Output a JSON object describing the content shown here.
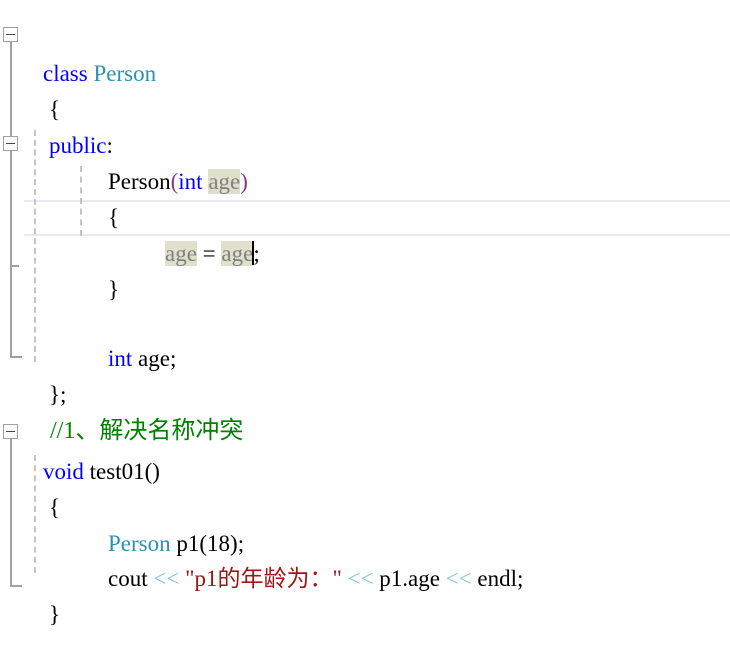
{
  "editor": {
    "language": "cpp",
    "colors": {
      "background": "#ffffff",
      "keyword": "#0000ff",
      "user_type": "#2b91af",
      "string": "#a31515",
      "comment": "#008000",
      "stream_operator": "#7fc3e0",
      "bracket_match": "#8b3a8b",
      "reference_highlight_bg": "#dfe0cb",
      "reference_highlight_fg": "#808080",
      "current_line_border": "#e9e9f3",
      "outline_margin": "#a0a0a0",
      "indent_guide": "#c4c4c4",
      "plain_text": "#000000"
    },
    "caret": {
      "line_index": 5,
      "after_text": "age"
    },
    "lines": [
      {
        "index": 0,
        "text": "class Person",
        "tokens": [
          {
            "t": "class",
            "c": "kw"
          },
          {
            "t": " ",
            "c": "plain"
          },
          {
            "t": "Person",
            "c": "type"
          }
        ]
      },
      {
        "index": 1,
        "text": "{",
        "tokens": [
          {
            "t": "{",
            "c": "brace"
          }
        ]
      },
      {
        "index": 2,
        "text": "public:",
        "tokens": [
          {
            "t": "public",
            "c": "kw"
          },
          {
            "t": ":",
            "c": "plain"
          }
        ]
      },
      {
        "index": 3,
        "text": "    Person(int age)",
        "tokens": [
          {
            "t": "Person",
            "c": "plain"
          },
          {
            "t": "(",
            "c": "bracket"
          },
          {
            "t": "int",
            "c": "kw"
          },
          {
            "t": " ",
            "c": "plain"
          },
          {
            "t": "age",
            "c": "refhl"
          },
          {
            "t": ")",
            "c": "bracket"
          }
        ]
      },
      {
        "index": 4,
        "text": "    {",
        "tokens": [
          {
            "t": "{",
            "c": "brace"
          }
        ]
      },
      {
        "index": 5,
        "text": "        age = age;",
        "tokens": [
          {
            "t": "age",
            "c": "refhl"
          },
          {
            "t": " = ",
            "c": "plain"
          },
          {
            "t": "age",
            "c": "refhl"
          },
          {
            "t": ";",
            "c": "plain"
          }
        ]
      },
      {
        "index": 6,
        "text": "    }",
        "tokens": [
          {
            "t": "}",
            "c": "brace"
          }
        ]
      },
      {
        "index": 7,
        "text": "",
        "tokens": []
      },
      {
        "index": 8,
        "text": "    int age;",
        "tokens": [
          {
            "t": "int",
            "c": "kw"
          },
          {
            "t": " age;",
            "c": "plain"
          }
        ]
      },
      {
        "index": 9,
        "text": "};",
        "tokens": [
          {
            "t": "};",
            "c": "plain"
          }
        ]
      },
      {
        "index": 10,
        "text": "//1、解决名称冲突",
        "tokens": [
          {
            "t": "//1、解决名称冲突",
            "c": "comment"
          }
        ]
      },
      {
        "index": 11,
        "text": "void test01()",
        "tokens": [
          {
            "t": "void",
            "c": "kw"
          },
          {
            "t": " test01()",
            "c": "plain"
          }
        ]
      },
      {
        "index": 12,
        "text": "{",
        "tokens": [
          {
            "t": "{",
            "c": "brace"
          }
        ]
      },
      {
        "index": 13,
        "text": "    Person p1(18);",
        "tokens": [
          {
            "t": "Person",
            "c": "type"
          },
          {
            "t": " p1(18);",
            "c": "plain"
          }
        ]
      },
      {
        "index": 14,
        "text": "    cout << \"p1的年龄为：\" << p1.age << endl;",
        "tokens": [
          {
            "t": "cout ",
            "c": "plain"
          },
          {
            "t": "<<",
            "c": "opshift"
          },
          {
            "t": " ",
            "c": "plain"
          },
          {
            "t": "\"p1的年龄为：\"",
            "c": "str"
          },
          {
            "t": " ",
            "c": "plain"
          },
          {
            "t": "<<",
            "c": "opshift"
          },
          {
            "t": " p1.age ",
            "c": "plain"
          },
          {
            "t": "<<",
            "c": "opshift"
          },
          {
            "t": " endl;",
            "c": "plain"
          }
        ]
      },
      {
        "index": 15,
        "text": "}",
        "tokens": [
          {
            "t": "}",
            "c": "brace"
          }
        ]
      }
    ],
    "fold_markers": [
      {
        "name": "fold-class-person",
        "line_index": 0,
        "state": "expanded",
        "glyph": "minus"
      },
      {
        "name": "fold-constructor",
        "line_index": 3,
        "state": "expanded",
        "glyph": "minus"
      },
      {
        "name": "fold-test01",
        "line_index": 11,
        "state": "expanded",
        "glyph": "minus"
      }
    ]
  }
}
